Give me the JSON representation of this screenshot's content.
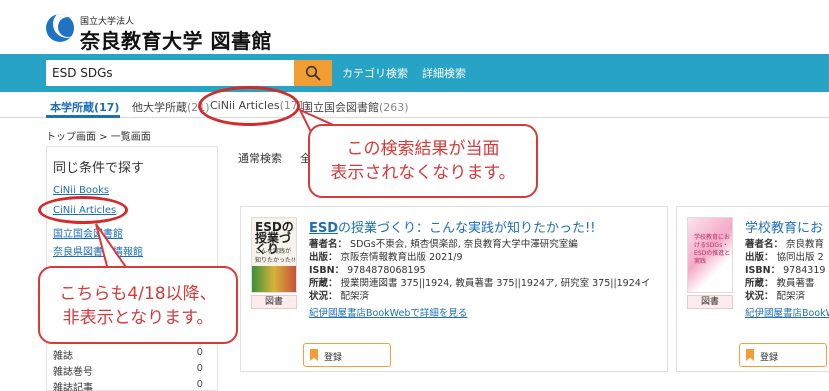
{
  "header": {
    "logo_sub": "国立大学法人",
    "logo_main": "奈良教育大学 図書館"
  },
  "search": {
    "query": "ESD SDGs",
    "category_link": "カテゴリ検索",
    "advanced_link": "詳細検索"
  },
  "tabs": [
    {
      "label": "本学所蔵",
      "count": "(17)"
    },
    {
      "label": "他大学所蔵",
      "count": "(21)"
    },
    {
      "label": "CiNii Articles",
      "count": "(171)"
    },
    {
      "label": "国立国会図書館",
      "count": "(263)"
    }
  ],
  "breadcrumb": "トップ画面 > 一覧画面",
  "side": {
    "title": "同じ条件で探す",
    "links": [
      "CiNii Books",
      "CiNii Articles",
      "国立国会図書館",
      "奈良県図書館情報館"
    ],
    "facets": [
      {
        "label": "雑誌",
        "count": "0"
      },
      {
        "label": "雑誌巻号",
        "count": "0"
      },
      {
        "label": "雑誌記事",
        "count": "0"
      }
    ]
  },
  "main": {
    "search_mode": "通常検索",
    "all_label": "全"
  },
  "results": [
    {
      "cover_title": "ESDの授業づくり",
      "cover_sub": "こんな実践が知りたかった!!",
      "type": "図書",
      "title_link": "ESD",
      "title_rest": "の授業づくり：こんな実践が知りたかった!!",
      "author_label": "著者名：",
      "author": "SDGs不東会, 頬杏倶楽部, 奈良教育大学中澤研究室編",
      "publisher_label": "出版：",
      "publisher": "京阪奈情報教育出版 2021/9",
      "isbn_label": "ISBN：",
      "isbn": "9784878068195",
      "holding_label": "所蔵：",
      "holding": "授業関連図書 375||1924, 教員著書 375||1924ア, 研究室 375||1924イ",
      "status_label": "状況：",
      "status": "配架済",
      "bookweb_link": "紀伊國屋書店BookWebで詳細を見る",
      "register_label": "登録"
    },
    {
      "cover_text": "学校教育におけるSDGs・ESDの推進と実践",
      "type": "図書",
      "title": "学校教育にお",
      "author_label": "著者名：",
      "author": "奈良教育",
      "publisher_label": "出版：",
      "publisher": "協同出版 2",
      "isbn_label": "ISBN：",
      "isbn": "9784319",
      "holding_label": "所蔵：",
      "holding": "教員著書",
      "status_label": "状況：",
      "status": "配架済",
      "bookweb_link": "紀伊國屋書店BookW",
      "register_label": "登録"
    }
  ],
  "annotations": {
    "callout1_line1": "この検索結果が当面",
    "callout1_line2": "表示されなくなります。",
    "callout2_line1": "こちらも4/18以降、",
    "callout2_line2": "非表示となります。"
  },
  "colors": {
    "accent_blue": "#1d6fb8",
    "search_bar": "#27a4c5",
    "search_button": "#f39c33",
    "annotation_red": "#d63a3a"
  }
}
